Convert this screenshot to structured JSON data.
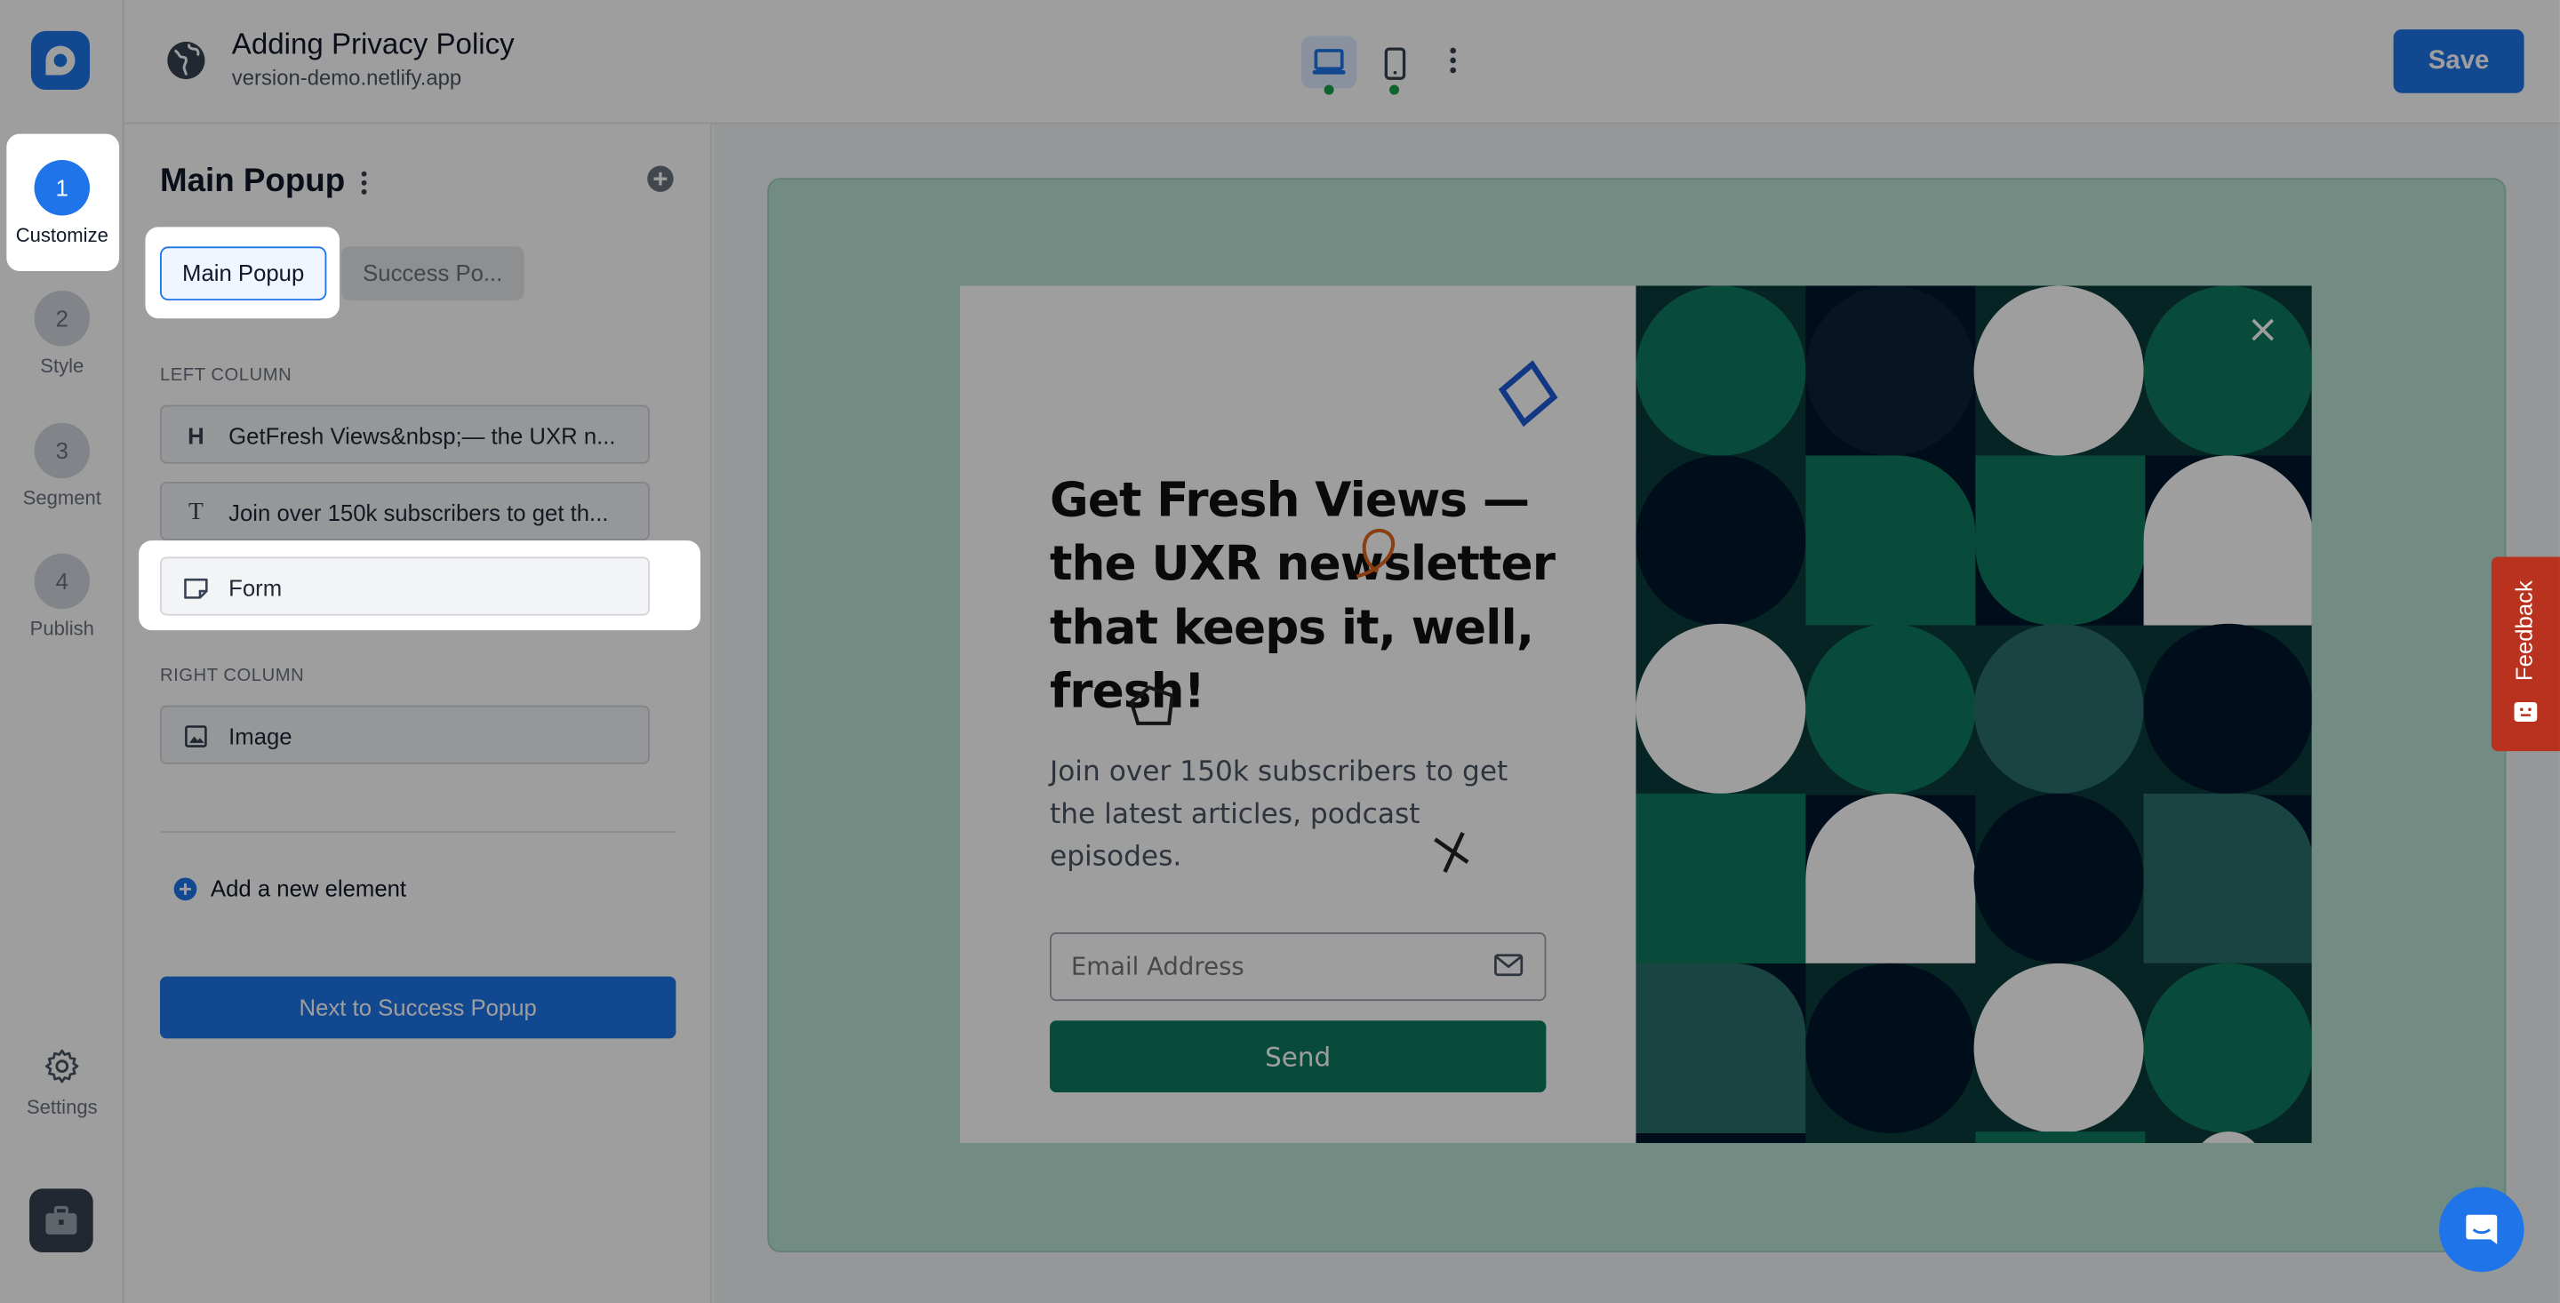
{
  "topbar": {
    "site_title": "Adding Privacy Policy",
    "site_url": "version-demo.netlify.app",
    "save_label": "Save"
  },
  "steps": [
    {
      "number": "1",
      "label": "Customize",
      "active": true
    },
    {
      "number": "2",
      "label": "Style",
      "active": false
    },
    {
      "number": "3",
      "label": "Segment",
      "active": false
    },
    {
      "number": "4",
      "label": "Publish",
      "active": false
    }
  ],
  "rail": {
    "settings_label": "Settings"
  },
  "panel": {
    "title": "Main Popup",
    "tabs": [
      {
        "label": "Main Popup",
        "selected": true
      },
      {
        "label": "Success Po...",
        "selected": false
      }
    ],
    "left_column_label": "LEFT COLUMN",
    "left_elements": [
      {
        "icon": "heading-icon",
        "glyph": "H",
        "label": "GetFresh Views&nbsp;— the UXR n..."
      },
      {
        "icon": "text-icon",
        "glyph": "T",
        "label": "Join over 150k subscribers to get th..."
      },
      {
        "icon": "form-icon",
        "glyph": "",
        "label": "Form"
      }
    ],
    "right_column_label": "RIGHT COLUMN",
    "right_elements": [
      {
        "icon": "image-icon",
        "glyph": "",
        "label": "Image"
      }
    ],
    "add_element_label": "Add a new element",
    "next_button_label": "Next to Success Popup"
  },
  "popup": {
    "heading": "Get Fresh Views — the UXR newsletter that keeps it, well, fresh!",
    "text": "Join over 150k subscribers to get the latest articles, podcast episodes.",
    "email_placeholder": "Email Address",
    "send_label": "Send"
  },
  "widgets": {
    "feedback_label": "Feedback"
  },
  "colors": {
    "accent": "#1e74e8",
    "popup_button": "#0f7a5e",
    "preview_background": "#b9e0d4",
    "pattern_green": "#0f7a5e",
    "pattern_navy": "#01152a",
    "pattern_teal": "#2b6e6a",
    "feedback": "#b8321f"
  }
}
